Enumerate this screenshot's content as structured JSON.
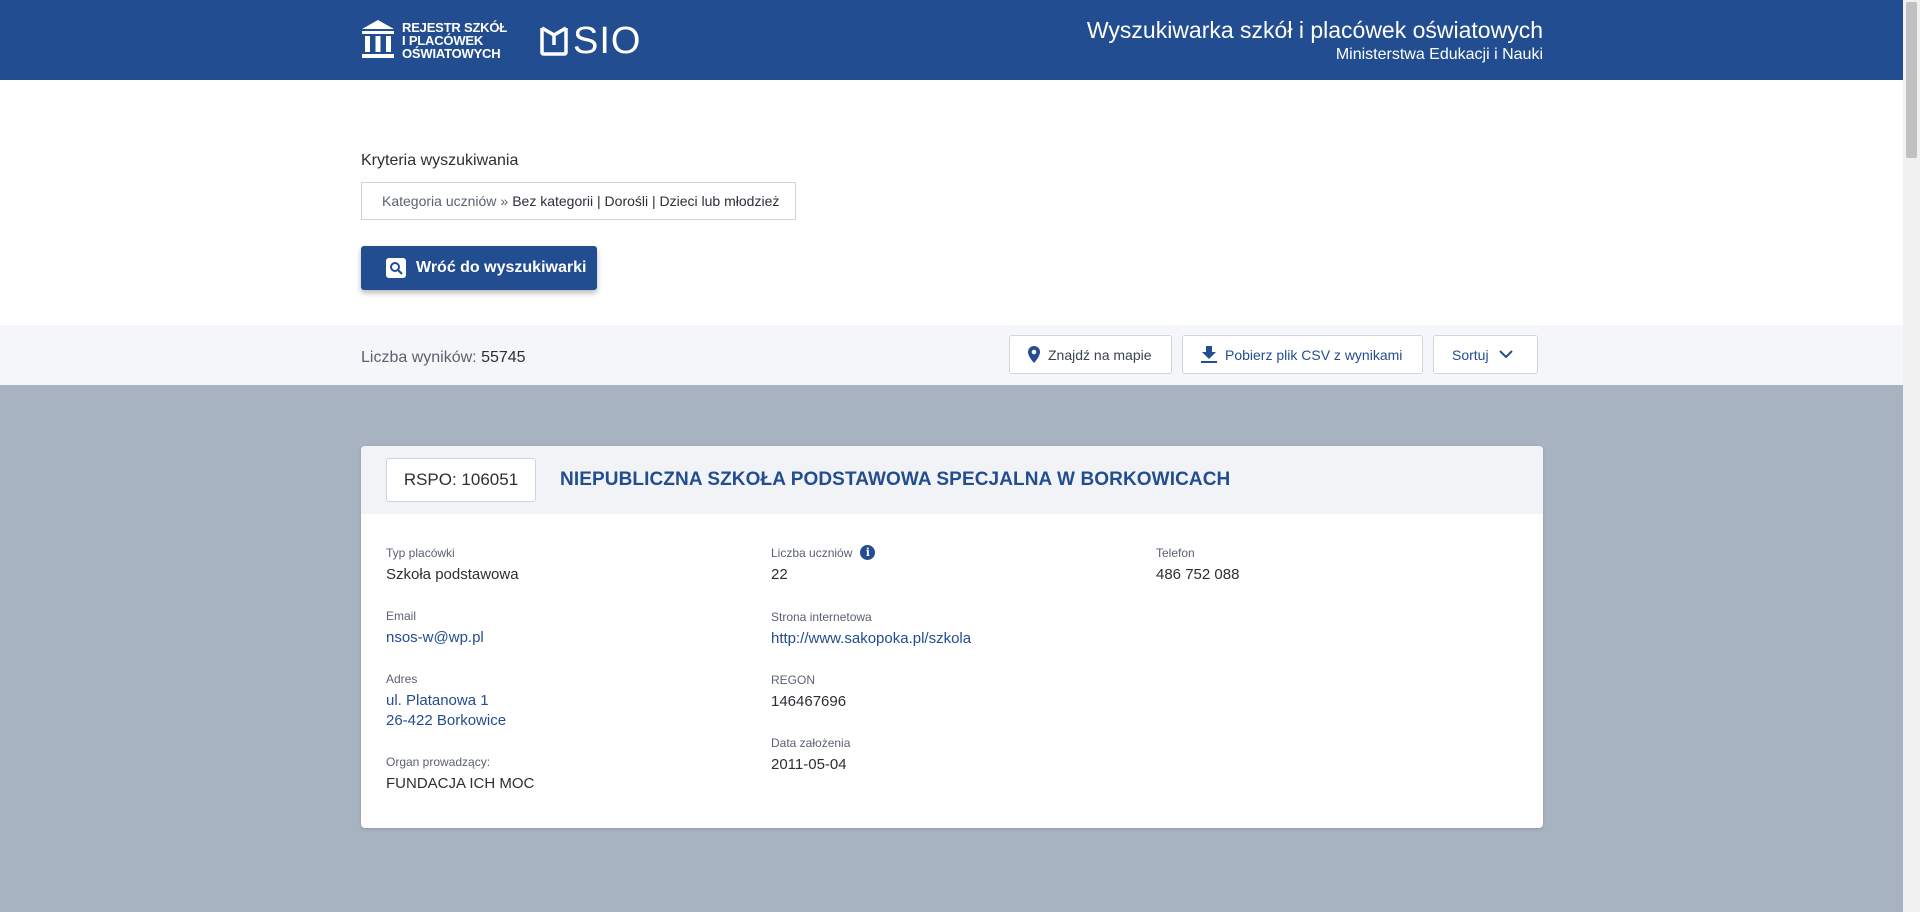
{
  "header": {
    "logo_rspo_line1": "REJESTR SZKÓŁ",
    "logo_rspo_line2": "I PLACÓWEK",
    "logo_rspo_line3": "OŚWIATOWYCH",
    "logo_sio": "SIO",
    "title": "Wyszukiwarka szkół i placówek oświatowych",
    "subtitle": "Ministerstwa Edukacji i Nauki"
  },
  "search": {
    "criteria_label": "Kryteria wyszukiwania",
    "criteria_key": "Kategoria uczniów",
    "criteria_separator": "»",
    "criteria_value": "Bez kategorii | Dorośli | Dzieci lub młodzież",
    "back_button_label": "Wróć do wyszukiwarki"
  },
  "results": {
    "count_label": "Liczba wyników:",
    "count_value": "55745",
    "map_button_label": "Znajdź na mapie",
    "csv_button_label": "Pobierz plik CSV z wynikami",
    "sort_button_label": "Sortuj"
  },
  "card": {
    "rspo_label": "RSPO: 106051",
    "title": "NIEPUBLICZNA SZKOŁA PODSTAWOWA SPECJALNA W BORKOWICACH",
    "fields": {
      "type_label": "Typ placówki",
      "type_value": "Szkoła podstawowa",
      "email_label": "Email",
      "email_value": "nsos-w@wp.pl",
      "address_label": "Adres",
      "address_line1": "ul. Platanowa 1",
      "address_line2": "26-422 Borkowice",
      "organ_label": "Organ prowadzący:",
      "organ_value": "FUNDACJA ICH MOC",
      "students_label": "Liczba uczniów",
      "students_value": "22",
      "website_label": "Strona internetowa",
      "website_value": "http://www.sakopoka.pl/szkola",
      "regon_label": "REGON",
      "regon_value": "146467696",
      "founded_label": "Data założenia",
      "founded_value": "2011-05-04",
      "phone_label": "Telefon",
      "phone_value": "486 752 088"
    }
  },
  "colors": {
    "brand_blue": "#234d91",
    "page_background": "#a8b3c2",
    "results_bar_background": "#f4f6f9"
  },
  "icons": {
    "rspo_logo": "building-columns-icon",
    "sio_logo": "book-s-icon",
    "back_button": "search-icon",
    "map_button": "map-pin-icon",
    "csv_button": "download-icon",
    "sort_button": "chevron-down-icon",
    "students_info": "info-icon"
  }
}
